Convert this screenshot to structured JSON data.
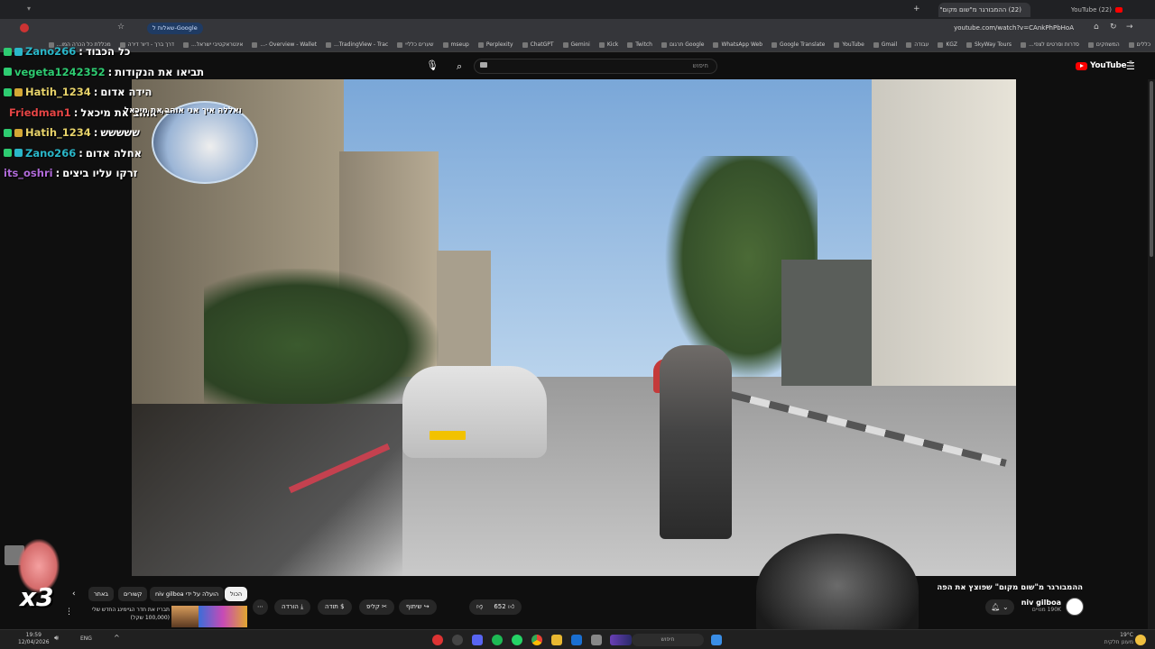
{
  "browser": {
    "tabs": [
      {
        "label": "(22) YouTube"
      },
      {
        "label": "(22) ההמבורגר מ\"שום מקום\" ש..."
      }
    ],
    "url": "youtube.com/watch?v=CAnkPhPbHoA",
    "google_pill": "שאלות ל-Google",
    "bookmarks": [
      "כללים",
      "המשחקים",
      "סדרות וסרטים לצפי...",
      "SkyWay Tours",
      "KGZ",
      "עבודה",
      "Gmail",
      "YouTube",
      "Google Translate",
      "WhatsApp Web",
      "Google תרגום",
      "Twitch",
      "Kick",
      "Gemini",
      "ChatGPT",
      "Perplexity",
      "mseup",
      "שערים כלליי",
      "TradingView - Trac...",
      "Overview - Wallet -...",
      "אינטראקטיבי ישראל...",
      "דרך ברך - דיור דירה",
      "מכללת כל הכרה המו..."
    ]
  },
  "youtube": {
    "search_placeholder": "חיפוש",
    "logo_text": "YouTube",
    "logo_sup": "IL"
  },
  "chat": [
    {
      "user": "Zano266",
      "user_color": "#2ab7c9",
      "msg": "כל הכבוד",
      "icons": [
        "green",
        "badge"
      ]
    },
    {
      "user": "vegeta1242352",
      "user_color": "#2ecc71",
      "msg": "תביאו את הנקודות",
      "icons": [
        "green"
      ]
    },
    {
      "user": "Hatih_1234",
      "user_color": "#e8d36a",
      "msg": "הידה אדום",
      "icons": [
        "green",
        "gold"
      ]
    },
    {
      "user": "Friedman1",
      "user_color": "#e64545",
      "msg": "ואללה איך אני אוהב את מיכאל",
      "icons": [
        "green",
        "gold"
      ]
    },
    {
      "user": "Hatih_1234",
      "user_color": "#e8d36a",
      "msg": "ששששש",
      "icons": [
        "green",
        "gold"
      ]
    },
    {
      "user": "Zano266",
      "user_color": "#2ab7c9",
      "msg": "אחלה אדום",
      "icons": [
        "green",
        "badge"
      ]
    },
    {
      "user": "its_oshri",
      "user_color": "#b06ad9",
      "msg": "זרקו עליו ביצים",
      "icons": []
    }
  ],
  "overlay": {
    "multiplier": "x3"
  },
  "video": {
    "title": "ההמבורגר מ\"שום מקום\" שפוצץ את הפה",
    "channel": "niv gilboa",
    "subscribers": "190K מנויים",
    "like_count": "652",
    "share": "שיתוף",
    "clip": "קליפ",
    "thanks": "תודה",
    "download": "הורדה"
  },
  "chips": [
    "הכול",
    "הועלה על ידי niv gilboa",
    "קשורים",
    "באתר"
  ],
  "recommendation": {
    "title": "תבריז את חדר הגיימינג החדש שלי (100,000 שקל)"
  },
  "taskbar": {
    "search": "חיפוש",
    "time": "19:59",
    "date": "12/04/2026",
    "lang": "ENG",
    "weather": "19°C",
    "weather_sub": "מעונן חלקית"
  }
}
